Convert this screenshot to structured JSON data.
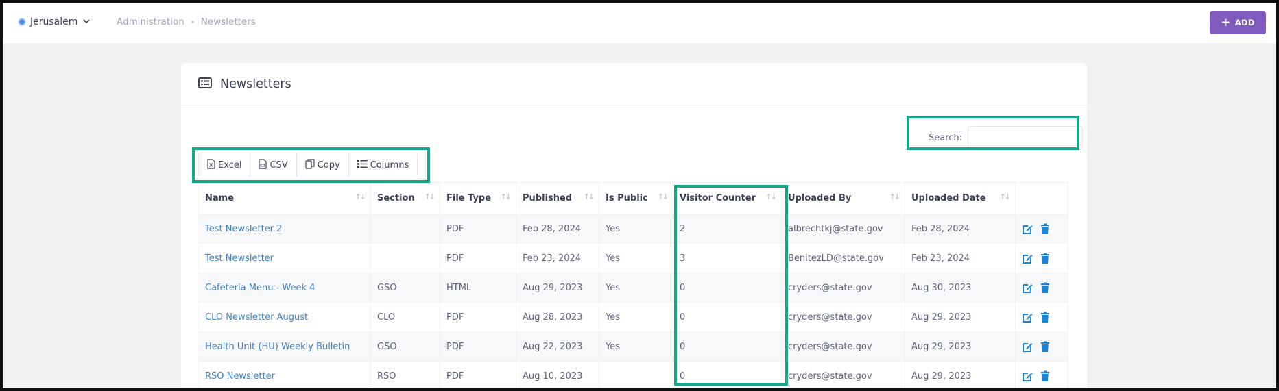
{
  "topbar": {
    "location": "Jerusalem",
    "breadcrumb": [
      "Administration",
      "Newsletters"
    ],
    "add_label": "ADD"
  },
  "card": {
    "title": "Newsletters",
    "search_label": "Search:",
    "search_value": "",
    "buttons": [
      "Excel",
      "CSV",
      "Copy",
      "Columns"
    ]
  },
  "table": {
    "columns": [
      "Name",
      "Section",
      "File Type",
      "Published",
      "Is Public",
      "Visitor Counter",
      "Uploaded By",
      "Uploaded Date",
      ""
    ],
    "rows": [
      {
        "name": "Test Newsletter 2",
        "section": "",
        "file_type": "PDF",
        "published": "Feb 28, 2024",
        "is_public": "Yes",
        "visitor_counter": "2",
        "uploaded_by": "albrechtkj@state.gov",
        "uploaded_date": "Feb 28, 2024"
      },
      {
        "name": "Test Newsletter",
        "section": "",
        "file_type": "PDF",
        "published": "Feb 23, 2024",
        "is_public": "Yes",
        "visitor_counter": "3",
        "uploaded_by": "BenitezLD@state.gov",
        "uploaded_date": "Feb 23, 2024"
      },
      {
        "name": "Cafeteria Menu - Week 4",
        "section": "GSO",
        "file_type": "HTML",
        "published": "Aug 29, 2023",
        "is_public": "Yes",
        "visitor_counter": "0",
        "uploaded_by": "cryders@state.gov",
        "uploaded_date": "Aug 30, 2023"
      },
      {
        "name": "CLO Newsletter August",
        "section": "CLO",
        "file_type": "PDF",
        "published": "Aug 28, 2023",
        "is_public": "Yes",
        "visitor_counter": "0",
        "uploaded_by": "cryders@state.gov",
        "uploaded_date": "Aug 29, 2023"
      },
      {
        "name": "Health Unit (HU) Weekly Bulletin",
        "section": "GSO",
        "file_type": "PDF",
        "published": "Aug 22, 2023",
        "is_public": "Yes",
        "visitor_counter": "0",
        "uploaded_by": "cryders@state.gov",
        "uploaded_date": "Aug 29, 2023"
      },
      {
        "name": "RSO Newsletter",
        "section": "RSO",
        "file_type": "PDF",
        "published": "Aug 10, 2023",
        "is_public": "",
        "visitor_counter": "0",
        "uploaded_by": "cryders@state.gov",
        "uploaded_date": "Aug 29, 2023"
      }
    ]
  },
  "colors": {
    "accent": "#7e5bbd",
    "link": "#3f7cc0",
    "action_icon": "#1b84d6",
    "highlight": "#14a88a"
  },
  "icons": {
    "location": "status-dot-icon",
    "add": "plus-icon",
    "card": "list-icon",
    "excel": "file-excel-icon",
    "csv": "file-csv-icon",
    "copy": "copy-icon",
    "columns": "columns-icon",
    "edit": "edit-icon",
    "delete": "trash-icon"
  }
}
